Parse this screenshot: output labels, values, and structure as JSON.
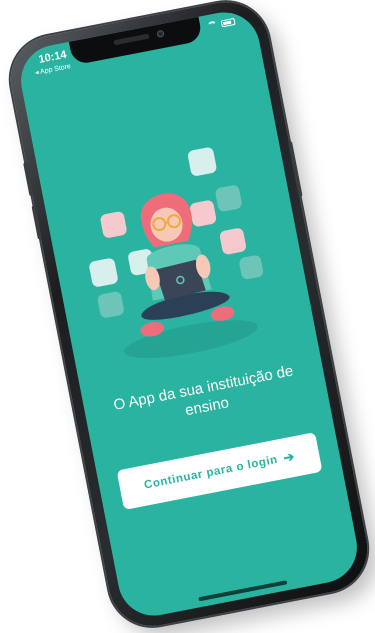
{
  "status_bar": {
    "time": "10:14",
    "back_label": "◂ App Store"
  },
  "onboarding": {
    "headline": "O App da sua instituição de ensino",
    "cta_label": "Continuar para o login",
    "cta_icon": "arrow-right-icon"
  },
  "colors": {
    "background": "#2bb3a2",
    "button_bg": "#ffffff",
    "button_text": "#2bb3a2",
    "tile_pink": "#f6c9cf",
    "tile_light": "#d7f0ec"
  }
}
